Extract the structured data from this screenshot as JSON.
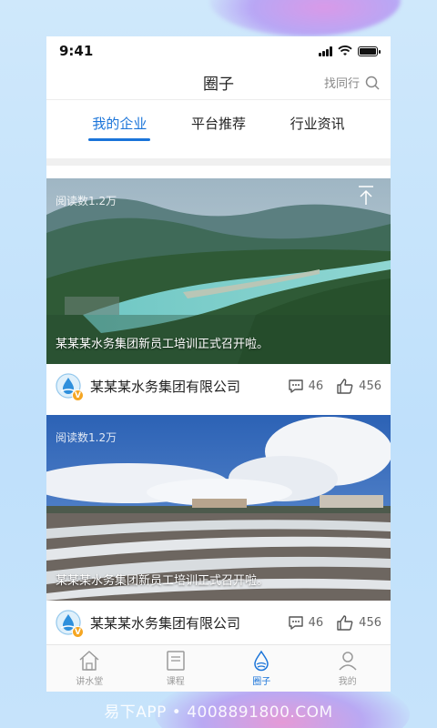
{
  "status_bar": {
    "time": "9:41"
  },
  "nav": {
    "title": "圈子",
    "find_peer_label": "找同行"
  },
  "tabs": [
    {
      "label": "我的企业",
      "active": true
    },
    {
      "label": "平台推荐",
      "active": false
    },
    {
      "label": "行业资讯",
      "active": false
    }
  ],
  "feed": [
    {
      "read_count": "阅读数1.2万",
      "caption": "某某某水务集团新员工培训正式召开啦。",
      "company": "某某某水务集团有限公司",
      "comments": "46",
      "likes": "456",
      "image_scene": "river-valley"
    },
    {
      "read_count": "阅读数1.2万",
      "caption": "某某某水务集团新员工培训正式召开啦。",
      "company": "某某某水务集团有限公司",
      "comments": "46",
      "likes": "456",
      "image_scene": "salt-flats"
    }
  ],
  "tab_bar": [
    {
      "label": "讲水堂",
      "icon": "house-icon",
      "active": false
    },
    {
      "label": "课程",
      "icon": "book-icon",
      "active": false
    },
    {
      "label": "圈子",
      "icon": "water-drop-icon",
      "active": true
    },
    {
      "label": "我的",
      "icon": "person-icon",
      "active": false
    }
  ],
  "watermark": "易下APP • 4008891800.COM",
  "colors": {
    "accent": "#1a74d9",
    "badge": "#f5a623",
    "background": "#c6e3fb"
  }
}
